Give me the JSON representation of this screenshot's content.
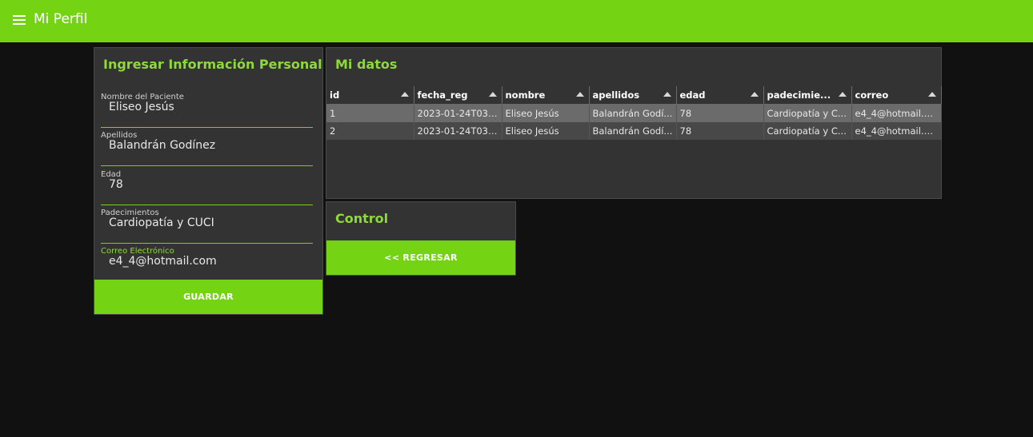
{
  "app": {
    "title": "Mi Perfil"
  },
  "form": {
    "title": "Ingresar Información Personal",
    "fields": [
      {
        "label": "Nombre del Paciente",
        "value": "Eliseo Jesús"
      },
      {
        "label": "Apellidos",
        "value": "Balandrán Godínez"
      },
      {
        "label": "Edad",
        "value": "78"
      },
      {
        "label": "Padecimientos",
        "value": "Cardiopatía y CUCI"
      },
      {
        "label": "Correo Electrónico",
        "value": "e4_4@hotmail.com"
      }
    ],
    "save_label": "GUARDAR"
  },
  "datos": {
    "title": "Mi datos",
    "columns": [
      "id",
      "fecha_reg",
      "nombre",
      "apellidos",
      "edad",
      "padecimie...",
      "correo"
    ],
    "rows": [
      [
        "1",
        "2023-01-24T03:...",
        "Eliseo Jesús",
        "Balandrán Godí...",
        "78",
        "Cardiopatía y C...",
        "e4_4@hotmail.c..."
      ],
      [
        "2",
        "2023-01-24T03:...",
        "Eliseo Jesús",
        "Balandrán Godí...",
        "78",
        "Cardiopatía y C...",
        "e4_4@hotmail.c..."
      ]
    ]
  },
  "control": {
    "title": "Control",
    "back_label": "<< REGRESAR"
  },
  "colors": {
    "accent": "#74d414",
    "title_accent": "#8ed93a",
    "panel": "#333333",
    "background": "#111111"
  },
  "icons": {
    "menu": "hamburger-menu-icon",
    "sort": "sort-ascending-icon"
  }
}
